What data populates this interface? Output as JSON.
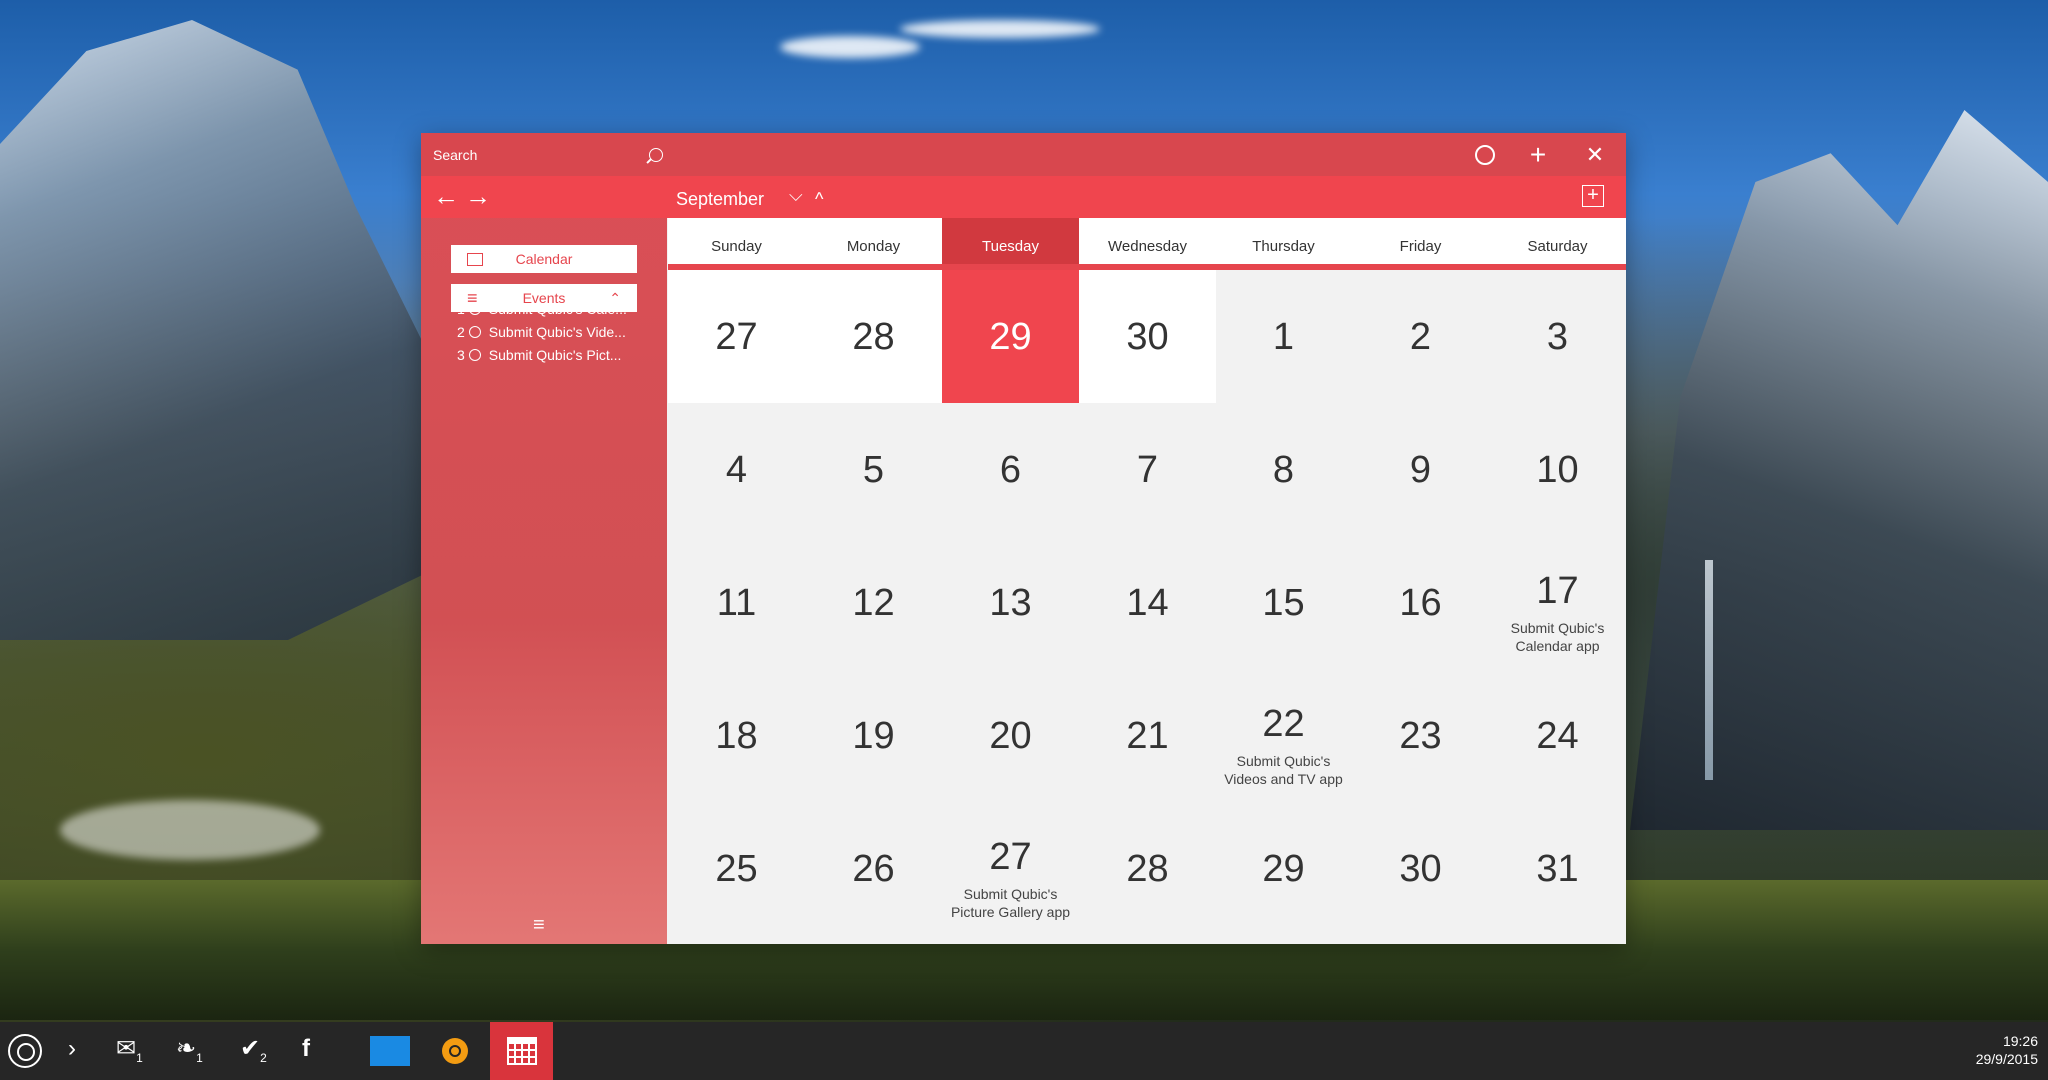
{
  "search": {
    "placeholder": "Search"
  },
  "titlebar": {
    "add_symbol": "+",
    "close_symbol": "✕"
  },
  "nav": {
    "back": "←",
    "forward": "→",
    "month": "September",
    "down": "⌵",
    "up": "^",
    "add_event": "+"
  },
  "sidebar": {
    "calendar_label": "Calendar",
    "events_label": "Events",
    "events": [
      {
        "num": "1",
        "text": "Submit Qubic's Cale..."
      },
      {
        "num": "2",
        "text": "Submit Qubic's Vide..."
      },
      {
        "num": "3",
        "text": "Submit Qubic's Pict..."
      }
    ],
    "menu": "≡"
  },
  "days": [
    "Sunday",
    "Monday",
    "Tuesday",
    "Wednesday",
    "Thursday",
    "Friday",
    "Saturday"
  ],
  "active_day": "Tuesday",
  "weeks": [
    [
      {
        "n": "27"
      },
      {
        "n": "28"
      },
      {
        "n": "29"
      },
      {
        "n": "30"
      },
      {
        "n": "1"
      },
      {
        "n": "2"
      },
      {
        "n": "3"
      }
    ],
    [
      {
        "n": "4"
      },
      {
        "n": "5"
      },
      {
        "n": "6"
      },
      {
        "n": "7"
      },
      {
        "n": "8"
      },
      {
        "n": "9"
      },
      {
        "n": "10"
      }
    ],
    [
      {
        "n": "11"
      },
      {
        "n": "12"
      },
      {
        "n": "13"
      },
      {
        "n": "14"
      },
      {
        "n": "15"
      },
      {
        "n": "16"
      },
      {
        "n": "17",
        "ev": "Submit Qubic's Calendar app"
      }
    ],
    [
      {
        "n": "18"
      },
      {
        "n": "19"
      },
      {
        "n": "20"
      },
      {
        "n": "21"
      },
      {
        "n": "22",
        "ev": "Submit Qubic's Videos and TV app"
      },
      {
        "n": "23"
      },
      {
        "n": "24"
      }
    ],
    [
      {
        "n": "25"
      },
      {
        "n": "26"
      },
      {
        "n": "27",
        "ev": "Submit Qubic's Picture Gallery app"
      },
      {
        "n": "28"
      },
      {
        "n": "29"
      },
      {
        "n": "30"
      },
      {
        "n": "31"
      }
    ]
  ],
  "taskbar": {
    "chevron": "›",
    "mail_count": "1",
    "twitter_count": "1",
    "other_count": "2",
    "facebook": "f",
    "time": "19:26",
    "date": "29/9/2015"
  },
  "colors": {
    "accent": "#f0454e",
    "accent_dark": "#d1393f"
  }
}
